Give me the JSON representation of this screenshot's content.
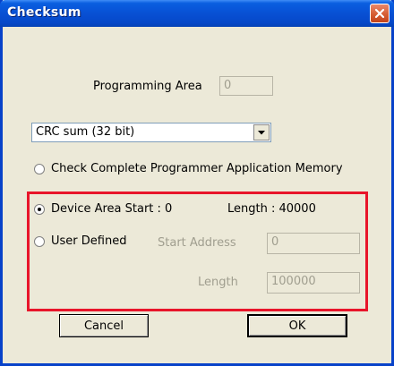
{
  "window": {
    "title": "Checksum"
  },
  "programming_area": {
    "label": "Programming Area",
    "value": "0"
  },
  "checksum_type": {
    "selected": "CRC sum (32 bit)"
  },
  "options": {
    "check_complete": {
      "label": "Check Complete Programmer Application Memory",
      "selected": false
    },
    "device_area": {
      "label": "Device Area Start : 0",
      "length_text": "Length : 40000",
      "selected": true
    },
    "user_defined": {
      "label": "User Defined",
      "selected": false
    }
  },
  "user_defined_fields": {
    "start_address_label": "Start Address",
    "start_address_value": "0",
    "length_label": "Length",
    "length_value": "100000"
  },
  "buttons": {
    "cancel": "Cancel",
    "ok": "OK"
  },
  "colors": {
    "titlebar": "#0850d4",
    "close": "#d45a2f",
    "highlight": "#e8152a",
    "dialog_bg": "#ece9d8"
  }
}
